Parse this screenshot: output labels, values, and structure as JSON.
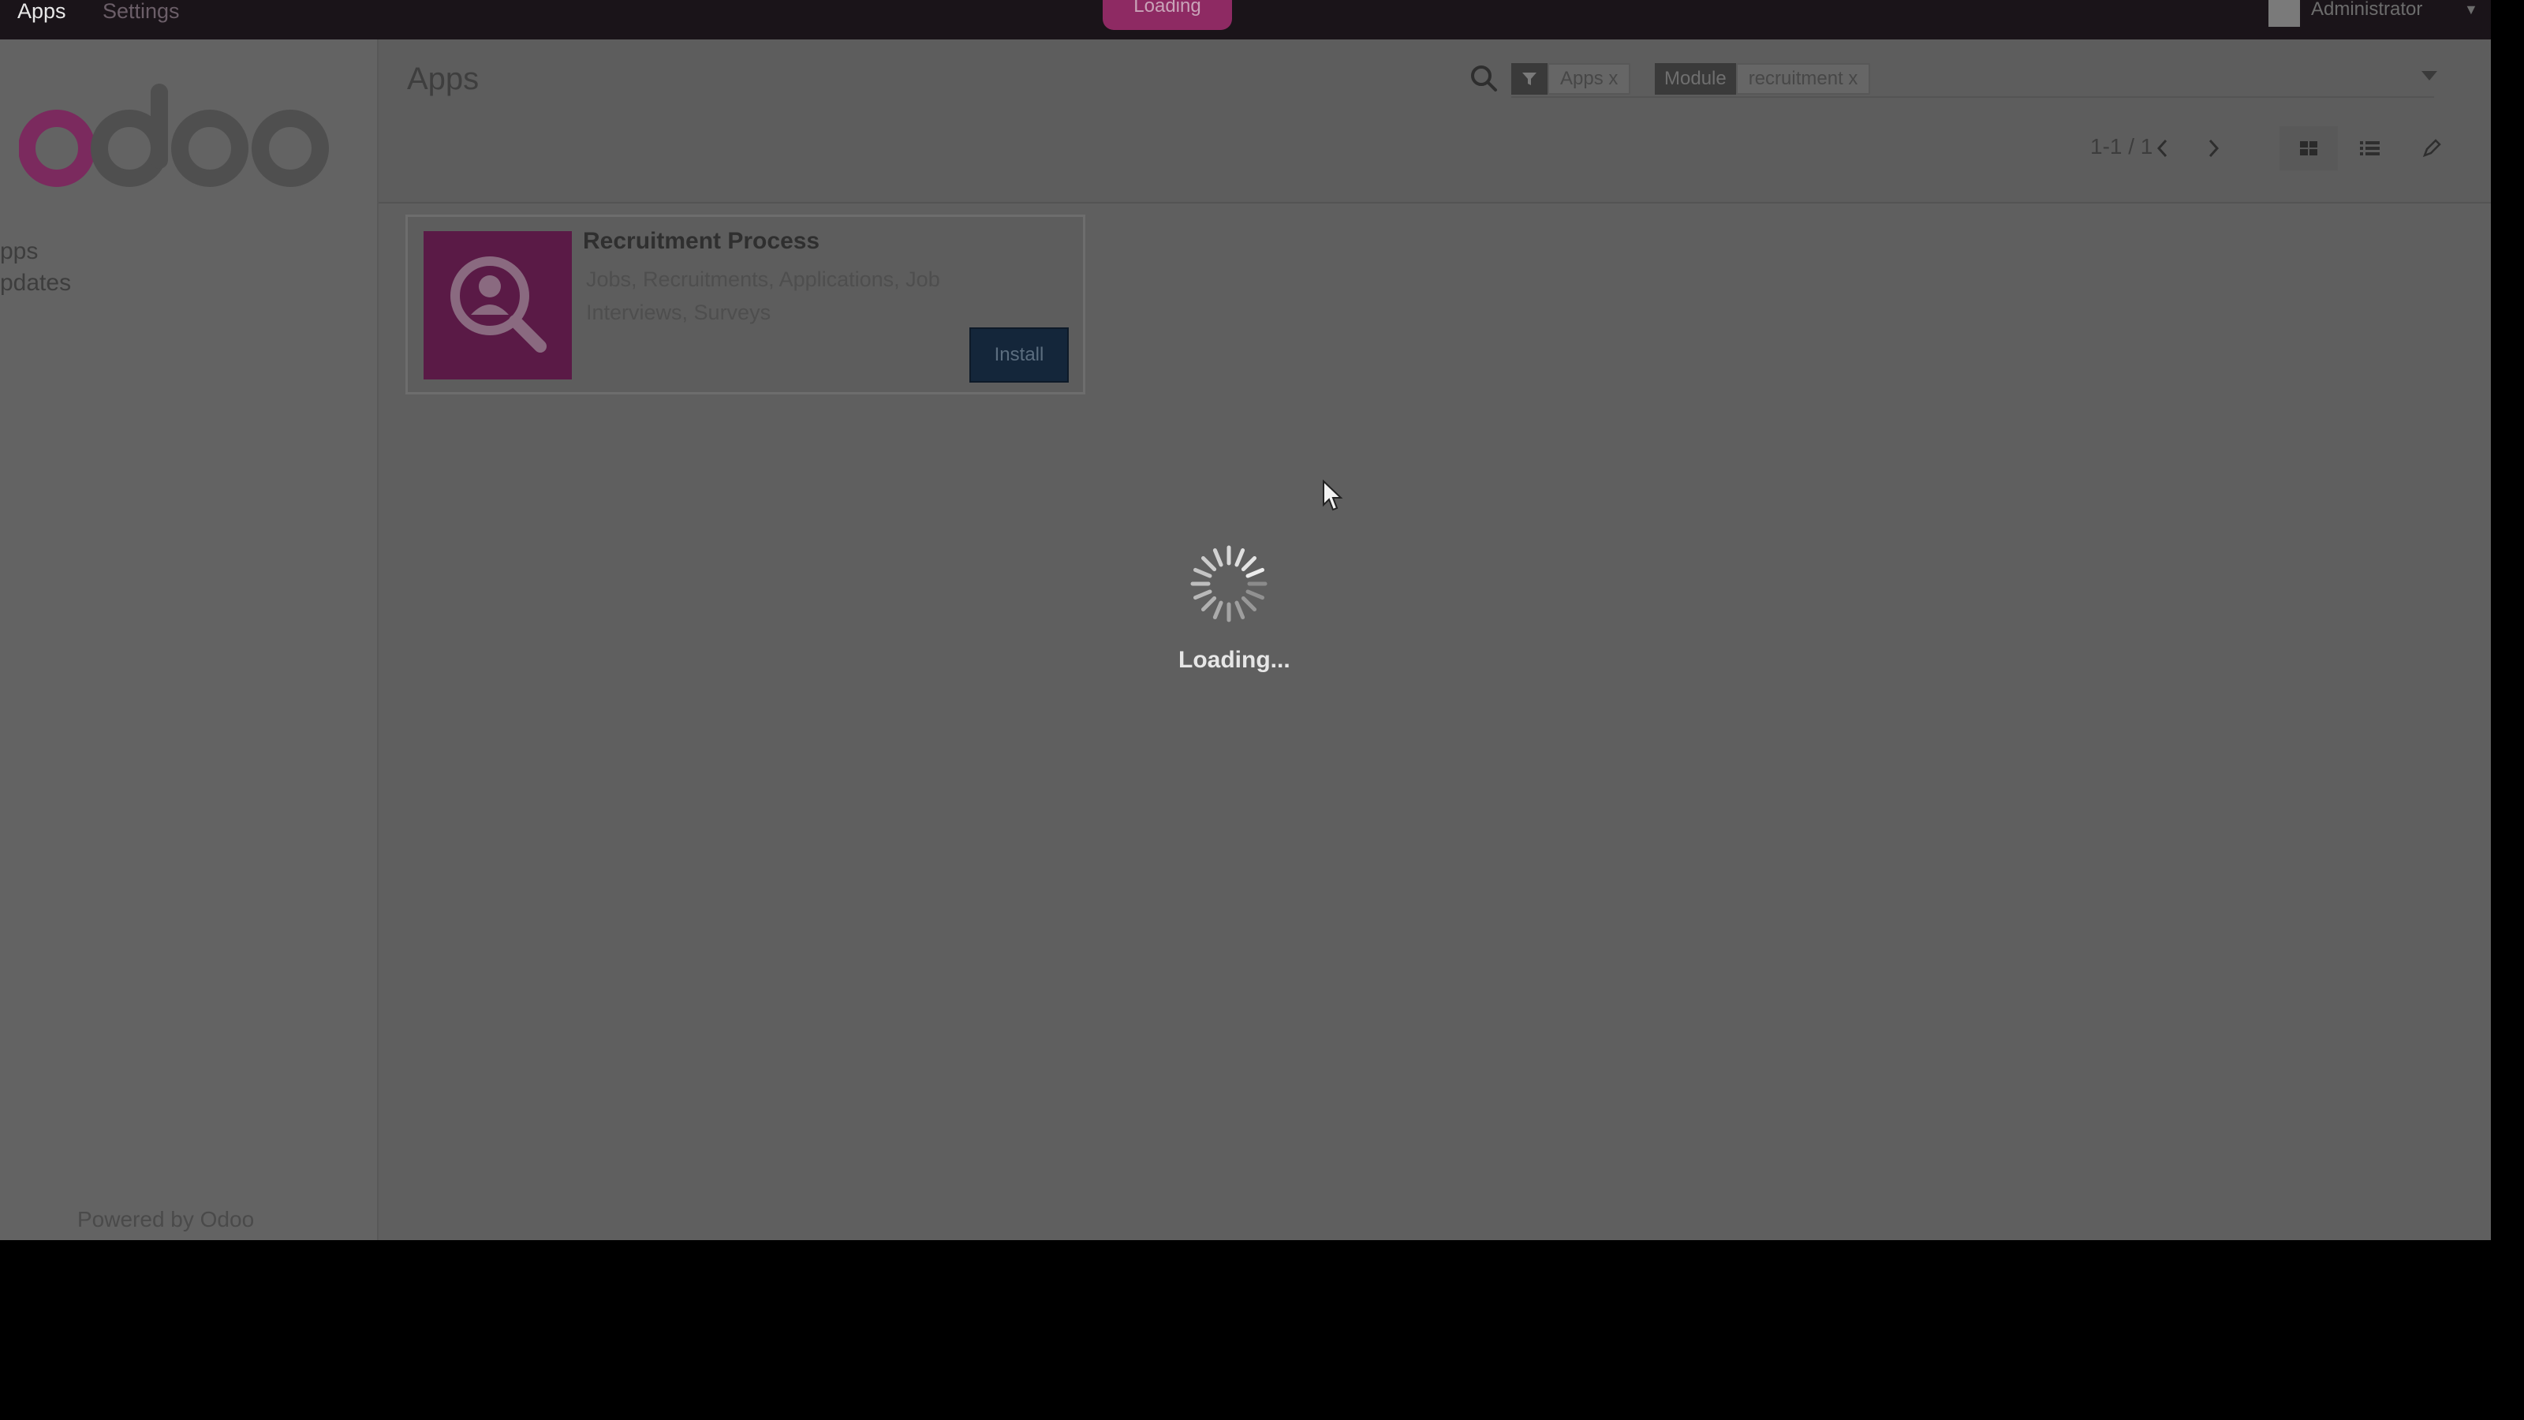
{
  "topbar": {
    "menu": [
      "Apps",
      "Settings"
    ],
    "loading_badge": "Loading",
    "user_name": "Administrator"
  },
  "sidebar": {
    "items": [
      "pps",
      "pdates"
    ],
    "powered_prefix": "Powered by",
    "powered_brand": "Odoo"
  },
  "control_panel": {
    "breadcrumb": "Apps",
    "facets": [
      {
        "label": "",
        "value": "Apps x",
        "icon": "filter-icon"
      },
      {
        "label": "Module",
        "value": "recruitment x"
      }
    ],
    "pager": "1-1 / 1"
  },
  "card": {
    "name": "Recruitment Process",
    "summary": "Jobs, Recruitments, Applications, Job Interviews, Surveys",
    "install_label": "Install"
  },
  "overlay": {
    "loading_text": "Loading..."
  },
  "colors": {
    "brand": "#875a7b",
    "install_button": "#14263a",
    "app_icon_bg": "#5a1a46"
  }
}
